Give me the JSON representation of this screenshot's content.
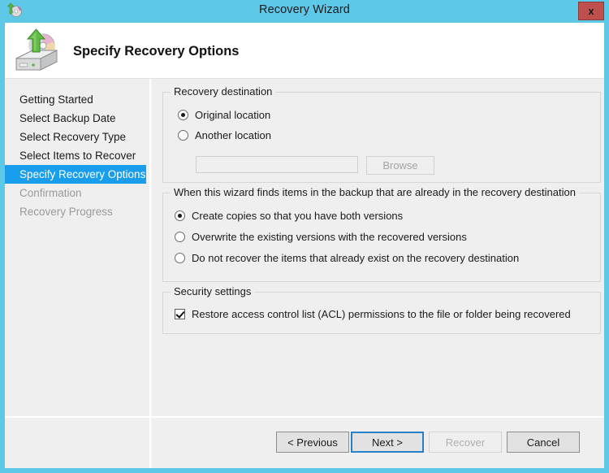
{
  "window": {
    "title": "Recovery Wizard",
    "icon": "recovery-disk-icon",
    "close_label": "x",
    "accent_color": "#5ec8e8",
    "close_color": "#c0504d"
  },
  "header": {
    "title": "Specify Recovery Options",
    "icon": "backup-disk-restore-icon"
  },
  "sidebar": {
    "items": [
      {
        "label": "Getting Started",
        "state": "done"
      },
      {
        "label": "Select Backup Date",
        "state": "done"
      },
      {
        "label": "Select Recovery Type",
        "state": "done"
      },
      {
        "label": "Select Items to Recover",
        "state": "done"
      },
      {
        "label": "Specify Recovery Options",
        "state": "active"
      },
      {
        "label": "Confirmation",
        "state": "upcoming"
      },
      {
        "label": "Recovery Progress",
        "state": "upcoming"
      }
    ],
    "active_color": "#199eee"
  },
  "destination_group": {
    "legend": "Recovery destination",
    "options": [
      {
        "label": "Original location",
        "selected": true
      },
      {
        "label": "Another location",
        "selected": false
      }
    ],
    "path_value": "",
    "path_placeholder": "",
    "browse_label": "Browse",
    "browse_enabled": false,
    "path_enabled": false
  },
  "conflict_group": {
    "legend": "When this wizard finds items in the backup that are already in the recovery destination",
    "options": [
      {
        "label": "Create copies so that you have both versions",
        "selected": true
      },
      {
        "label": "Overwrite the existing versions with the recovered versions",
        "selected": false
      },
      {
        "label": "Do not recover the items that already exist on the recovery destination",
        "selected": false
      }
    ]
  },
  "security_group": {
    "legend": "Security settings",
    "checkbox": {
      "label": "Restore access control list (ACL) permissions to the file or folder being recovered",
      "checked": true
    }
  },
  "buttons": {
    "previous": {
      "label": "< Previous",
      "enabled": true,
      "default": false
    },
    "next": {
      "label": "Next >",
      "enabled": true,
      "default": true
    },
    "recover": {
      "label": "Recover",
      "enabled": false,
      "default": false
    },
    "cancel": {
      "label": "Cancel",
      "enabled": true,
      "default": false
    }
  }
}
